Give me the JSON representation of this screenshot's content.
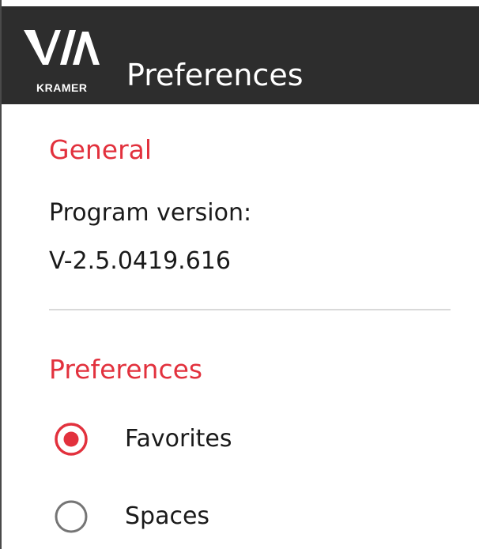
{
  "header": {
    "logo_text": "VIA",
    "logo_subtext": "KRAMER",
    "title": "Preferences"
  },
  "general": {
    "heading": "General",
    "program_version_label": "Program version:",
    "program_version_value": "V-2.5.0419.616"
  },
  "preferences": {
    "heading": "Preferences",
    "options": [
      {
        "label": "Favorites",
        "selected": true
      },
      {
        "label": "Spaces",
        "selected": false
      }
    ]
  },
  "colors": {
    "header_bg": "#2d2d2d",
    "accent_red": "#e2313d",
    "text_dark": "#1a1a1a",
    "divider": "#d9d9d9",
    "radio_unselected": "#757575"
  }
}
